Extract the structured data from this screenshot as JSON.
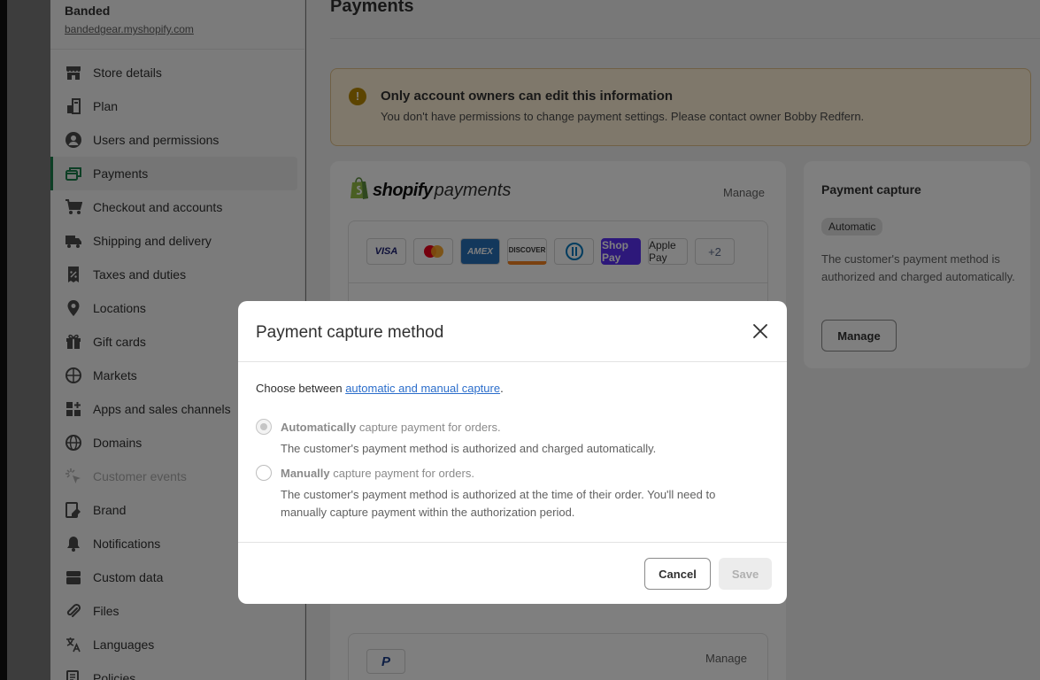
{
  "store": {
    "name": "Banded",
    "url": "bandedgear.myshopify.com"
  },
  "sidebar": {
    "items": [
      {
        "label": "Store details",
        "icon": "store-icon"
      },
      {
        "label": "Plan",
        "icon": "plan-icon"
      },
      {
        "label": "Users and permissions",
        "icon": "user-icon"
      },
      {
        "label": "Payments",
        "icon": "payments-icon",
        "active": true
      },
      {
        "label": "Checkout and accounts",
        "icon": "cart-icon"
      },
      {
        "label": "Shipping and delivery",
        "icon": "truck-icon"
      },
      {
        "label": "Taxes and duties",
        "icon": "tax-icon"
      },
      {
        "label": "Locations",
        "icon": "location-pin-icon"
      },
      {
        "label": "Gift cards",
        "icon": "gift-icon"
      },
      {
        "label": "Markets",
        "icon": "globe-icon"
      },
      {
        "label": "Apps and sales channels",
        "icon": "apps-icon"
      },
      {
        "label": "Domains",
        "icon": "globe-icon"
      },
      {
        "label": "Customer events",
        "icon": "cursor-icon",
        "disabled": true
      },
      {
        "label": "Brand",
        "icon": "brand-icon"
      },
      {
        "label": "Notifications",
        "icon": "bell-icon"
      },
      {
        "label": "Custom data",
        "icon": "database-icon"
      },
      {
        "label": "Files",
        "icon": "paperclip-icon"
      },
      {
        "label": "Languages",
        "icon": "language-icon"
      },
      {
        "label": "Policies",
        "icon": "policies-icon"
      }
    ]
  },
  "main": {
    "title": "Payments",
    "banner": {
      "title": "Only account owners can edit this information",
      "text": "You don't have permissions to change payment settings. Please contact owner Bobby Redfern."
    },
    "shopify_payments": {
      "logo_bold": "shopify",
      "logo_light": "payments",
      "manage": "Manage",
      "methods": [
        "VISA",
        "Mastercard",
        "AMEX",
        "DISCOVER",
        "Diners",
        "Shop Pay",
        "Apple Pay",
        "+2"
      ]
    },
    "paypal": {
      "manage": "Manage",
      "logo": "P"
    },
    "capture_card": {
      "title": "Payment capture",
      "badge": "Automatic",
      "text": "The customer's payment method is authorized and charged automatically.",
      "button": "Manage"
    }
  },
  "modal": {
    "title": "Payment capture method",
    "intro_prefix": "Choose between ",
    "intro_link": "automatic and manual capture",
    "intro_suffix": ".",
    "options": [
      {
        "bold": "Automatically",
        "rest": " capture payment for orders.",
        "help": "The customer's payment method is authorized and charged automatically.",
        "checked": true
      },
      {
        "bold": "Manually",
        "rest": " capture payment for orders.",
        "help": "The customer's payment method is authorized at the time of their order. You'll need to manually capture payment within the authorization period.",
        "checked": false
      }
    ],
    "cancel": "Cancel",
    "save": "Save"
  }
}
